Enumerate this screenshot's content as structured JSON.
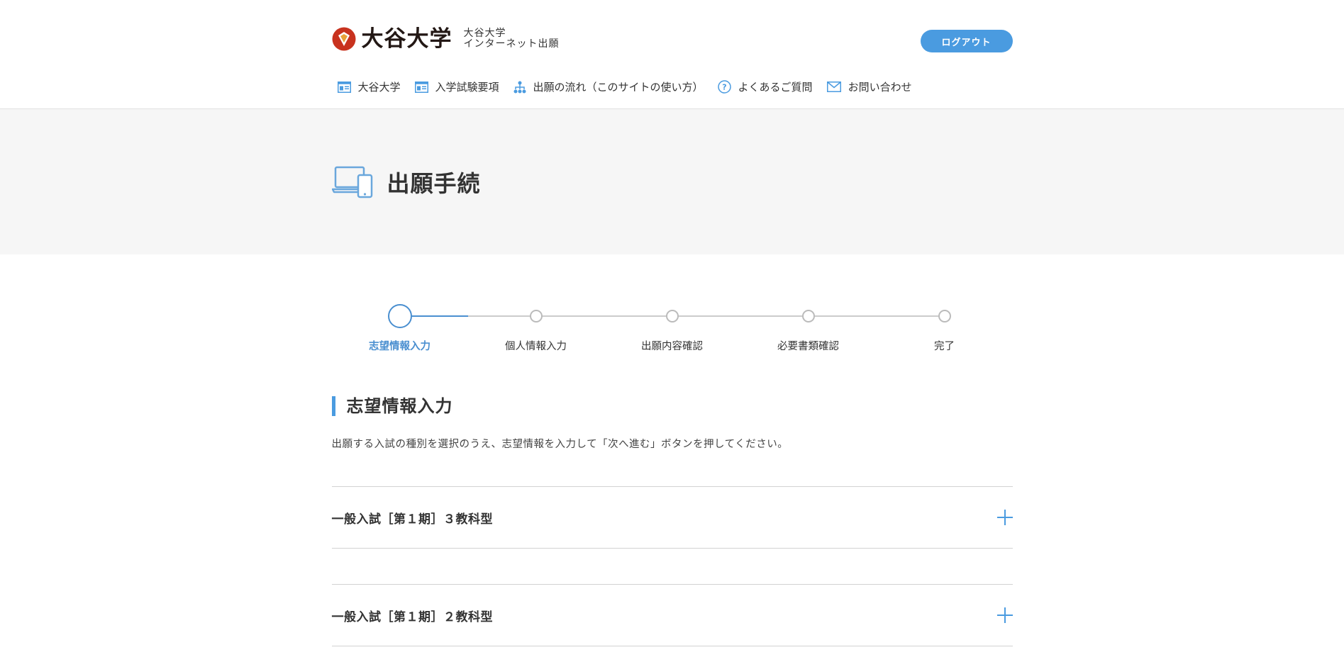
{
  "header": {
    "logo_text": "大谷大学",
    "subtitle_line1": "大谷大学",
    "subtitle_line2": "インターネット出願",
    "logout_label": "ログアウト",
    "nav": [
      {
        "label": "大谷大学",
        "icon": "window-icon"
      },
      {
        "label": "入学試験要項",
        "icon": "window-icon"
      },
      {
        "label": "出願の流れ（このサイトの使い方）",
        "icon": "sitemap-icon"
      },
      {
        "label": "よくあるご質問",
        "icon": "question-icon"
      },
      {
        "label": "お問い合わせ",
        "icon": "mail-icon"
      }
    ]
  },
  "hero": {
    "title": "出願手続",
    "icon": "devices-icon"
  },
  "stepper": {
    "current": 0,
    "steps": [
      {
        "label": "志望情報入力"
      },
      {
        "label": "個人情報入力"
      },
      {
        "label": "出願内容確認"
      },
      {
        "label": "必要書類確認"
      },
      {
        "label": "完了"
      }
    ]
  },
  "section": {
    "title": "志望情報入力",
    "description": "出願する入試の種別を選択のうえ、志望情報を入力して「次へ進む」ボタンを押してください。"
  },
  "accordion": [
    {
      "label": "一般入試［第１期］３教科型"
    },
    {
      "label": "一般入試［第１期］２教科型"
    }
  ],
  "colors": {
    "accent": "#4a9be0",
    "step_active": "#4a8fd0",
    "logo_red": "#c8321e"
  }
}
